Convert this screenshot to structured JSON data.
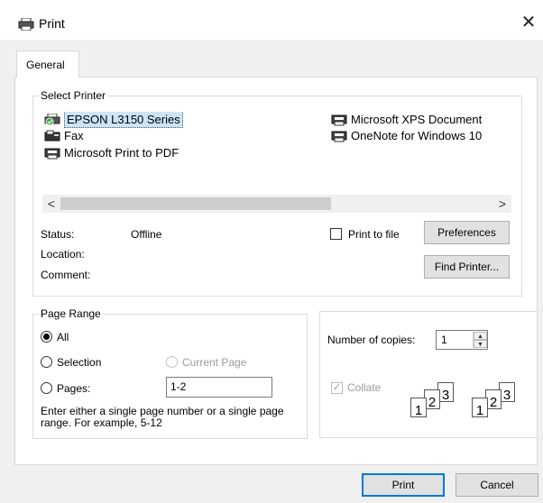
{
  "window": {
    "title": "Print",
    "close_glyph": "✕"
  },
  "tabs": [
    {
      "label": "General"
    }
  ],
  "select_printer": {
    "legend": "Select Printer",
    "printers": [
      {
        "name": "EPSON L3150 Series",
        "icon": "printer-default-icon",
        "selected": true
      },
      {
        "name": "Fax",
        "icon": "fax-icon",
        "selected": false
      },
      {
        "name": "Microsoft Print to PDF",
        "icon": "printer-icon",
        "selected": false
      },
      {
        "name": "Microsoft XPS Document",
        "icon": "printer-icon",
        "selected": false
      },
      {
        "name": "OneNote for Windows 10",
        "icon": "printer-icon",
        "selected": false
      }
    ],
    "scroll_left": "<",
    "scroll_right": ">",
    "status_label": "Status:",
    "status_value": "Offline",
    "location_label": "Location:",
    "comment_label": "Comment:",
    "print_to_file_label": "Print to file",
    "print_to_file_checked": false,
    "preferences_button": "Preferences",
    "find_printer_button": "Find Printer..."
  },
  "page_range": {
    "legend": "Page Range",
    "all_label": "All",
    "selection_label": "Selection",
    "current_page_label": "Current Page",
    "pages_label": "Pages:",
    "pages_value": "1-2",
    "selected_option": "All",
    "hint": "Enter either a single page number or a single page range.  For example, 5-12"
  },
  "copies": {
    "number_label": "Number of copies:",
    "number_value": "1",
    "collate_label": "Collate",
    "collate_checked": true,
    "collate_pages": [
      "1",
      "2",
      "3"
    ]
  },
  "footer": {
    "print_button": "Print",
    "cancel_button": "Cancel"
  },
  "colors": {
    "selection_bg": "#cce4f7",
    "default_button_border": "#0078d7",
    "online_badge": "#3aa835"
  }
}
